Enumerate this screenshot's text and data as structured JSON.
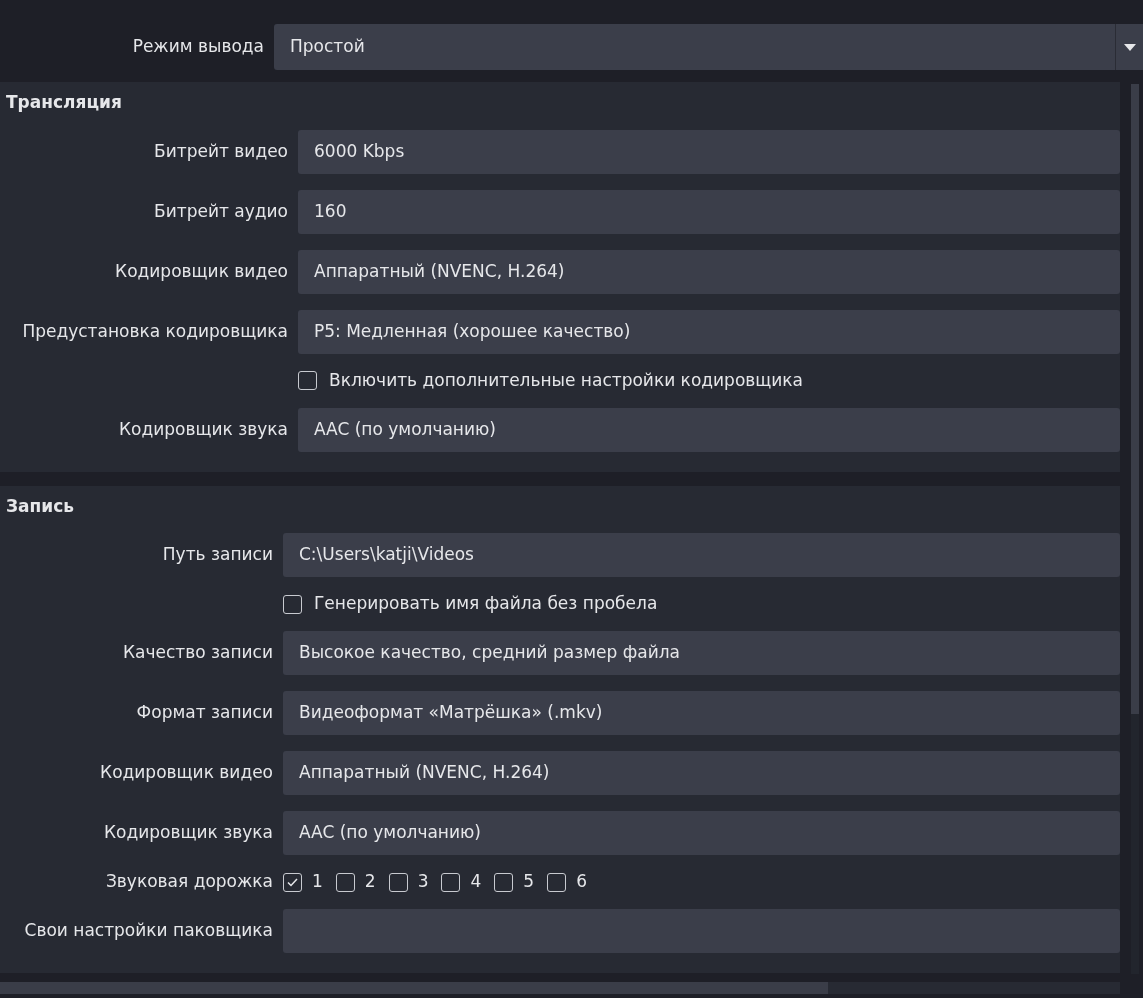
{
  "output_mode": {
    "label": "Режим вывода",
    "value": "Простой"
  },
  "sections": [
    {
      "title": "Трансляция",
      "rows": [
        {
          "kind": "field",
          "label": "Битрейт видео",
          "value": "6000 Kbps"
        },
        {
          "kind": "field",
          "label": "Битрейт аудио",
          "value": "160"
        },
        {
          "kind": "field",
          "label": "Кодировщик видео",
          "value": "Аппаратный (NVENC, H.264)"
        },
        {
          "kind": "field",
          "label": "Предустановка кодировщика",
          "value": "P5: Медленная (хорошее качество)"
        },
        {
          "kind": "checkbox",
          "label": "Включить дополнительные настройки кодировщика",
          "checked": false
        },
        {
          "kind": "field",
          "label": "Кодировщик звука",
          "value": "AAC (по умолчанию)"
        }
      ]
    },
    {
      "title": "Запись",
      "rows": [
        {
          "kind": "field",
          "label": "Путь записи",
          "value": "C:\\Users\\katji\\Videos"
        },
        {
          "kind": "checkbox",
          "label": "Генерировать имя файла без пробела",
          "checked": false
        },
        {
          "kind": "field",
          "label": "Качество записи",
          "value": "Высокое качество, средний размер файла"
        },
        {
          "kind": "field",
          "label": "Формат записи",
          "value": "Видеоформат «Матрёшка» (.mkv)"
        },
        {
          "kind": "field",
          "label": "Кодировщик видео",
          "value": "Аппаратный (NVENC, H.264)"
        },
        {
          "kind": "field",
          "label": "Кодировщик звука",
          "value": "AAC (по умолчанию)"
        },
        {
          "kind": "tracks",
          "label": "Звуковая дорожка",
          "tracks": [
            {
              "label": "1",
              "checked": true
            },
            {
              "label": "2",
              "checked": false
            },
            {
              "label": "3",
              "checked": false
            },
            {
              "label": "4",
              "checked": false
            },
            {
              "label": "5",
              "checked": false
            },
            {
              "label": "6",
              "checked": false
            }
          ]
        },
        {
          "kind": "field",
          "label": "Свои настройки паковщика"
        }
      ]
    }
  ]
}
